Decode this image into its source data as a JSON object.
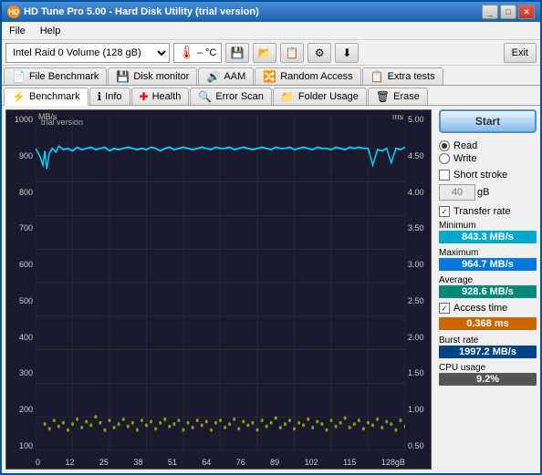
{
  "window": {
    "title": "HD Tune Pro 5.00 - Hard Disk Utility (trial version)",
    "icon": "HD"
  },
  "menu": {
    "items": [
      "File",
      "Help"
    ]
  },
  "toolbar": {
    "drive": "Intel  Raid 0 Volume (128 gB)",
    "temp": "– °C",
    "exit_label": "Exit"
  },
  "tabs_row1": [
    {
      "id": "file-benchmark",
      "label": "File Benchmark",
      "icon": "📄"
    },
    {
      "id": "disk-monitor",
      "label": "Disk monitor",
      "icon": "💾"
    },
    {
      "id": "aam",
      "label": "AAM",
      "icon": "🔊"
    },
    {
      "id": "random-access",
      "label": "Random Access",
      "icon": "🔀"
    },
    {
      "id": "extra-tests",
      "label": "Extra tests",
      "icon": "📋"
    }
  ],
  "tabs_row2": [
    {
      "id": "benchmark",
      "label": "Benchmark",
      "icon": "⚡",
      "active": true
    },
    {
      "id": "info",
      "label": "Info",
      "icon": "ℹ"
    },
    {
      "id": "health",
      "label": "Health",
      "icon": "❤"
    },
    {
      "id": "error-scan",
      "label": "Error Scan",
      "icon": "🔍"
    },
    {
      "id": "folder-usage",
      "label": "Folder Usage",
      "icon": "📁"
    },
    {
      "id": "erase",
      "label": "Erase",
      "icon": "🗑"
    }
  ],
  "chart": {
    "title_left": "MB/s",
    "title_right": "ms",
    "trial_text": "trial version",
    "y_labels_left": [
      "1000",
      "900",
      "800",
      "700",
      "600",
      "500",
      "400",
      "300",
      "200",
      "100"
    ],
    "y_labels_right": [
      "5.00",
      "4.50",
      "4.00",
      "3.50",
      "3.00",
      "2.50",
      "2.00",
      "1.50",
      "1.00",
      "0.50"
    ],
    "x_labels": [
      "0",
      "12",
      "25",
      "38",
      "51",
      "64",
      "76",
      "89",
      "102",
      "115",
      "128gB"
    ]
  },
  "controls": {
    "start_label": "Start",
    "read_label": "Read",
    "write_label": "Write",
    "short_stroke_label": "Short stroke",
    "gb_value": "40",
    "gb_label": "gB",
    "transfer_rate_label": "Transfer rate",
    "minimum_label": "Minimum",
    "minimum_value": "843.3 MB/s",
    "maximum_label": "Maximum",
    "maximum_value": "964.7 MB/s",
    "average_label": "Average",
    "average_value": "928.6 MB/s",
    "access_time_label": "Access time",
    "access_time_value": "0.368 ms",
    "burst_rate_label": "Burst rate",
    "burst_rate_value": "1997.2 MB/s",
    "cpu_usage_label": "CPU usage",
    "cpu_usage_value": "9.2%"
  }
}
